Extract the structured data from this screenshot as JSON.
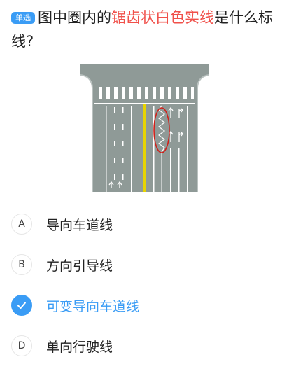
{
  "question": {
    "badge": "单选",
    "text_before": "图中圈内的",
    "text_highlight": "锯齿状白色实线",
    "text_after": "是什么标线?"
  },
  "options": [
    {
      "letter": "A",
      "text": "导向车道线",
      "selected": false
    },
    {
      "letter": "B",
      "text": "方向引导线",
      "selected": false
    },
    {
      "letter": "C",
      "text": "可变导向车道线",
      "selected": true
    },
    {
      "letter": "D",
      "text": "单向行驶线",
      "selected": false
    }
  ],
  "colors": {
    "accent": "#3a9cf5",
    "highlight": "#f0504a",
    "road": "#8f9a97",
    "center_line": "#e8d400",
    "marking": "#ffffff",
    "circle_annotation": "#d0201a"
  },
  "icons": {
    "selected": "check-icon"
  }
}
